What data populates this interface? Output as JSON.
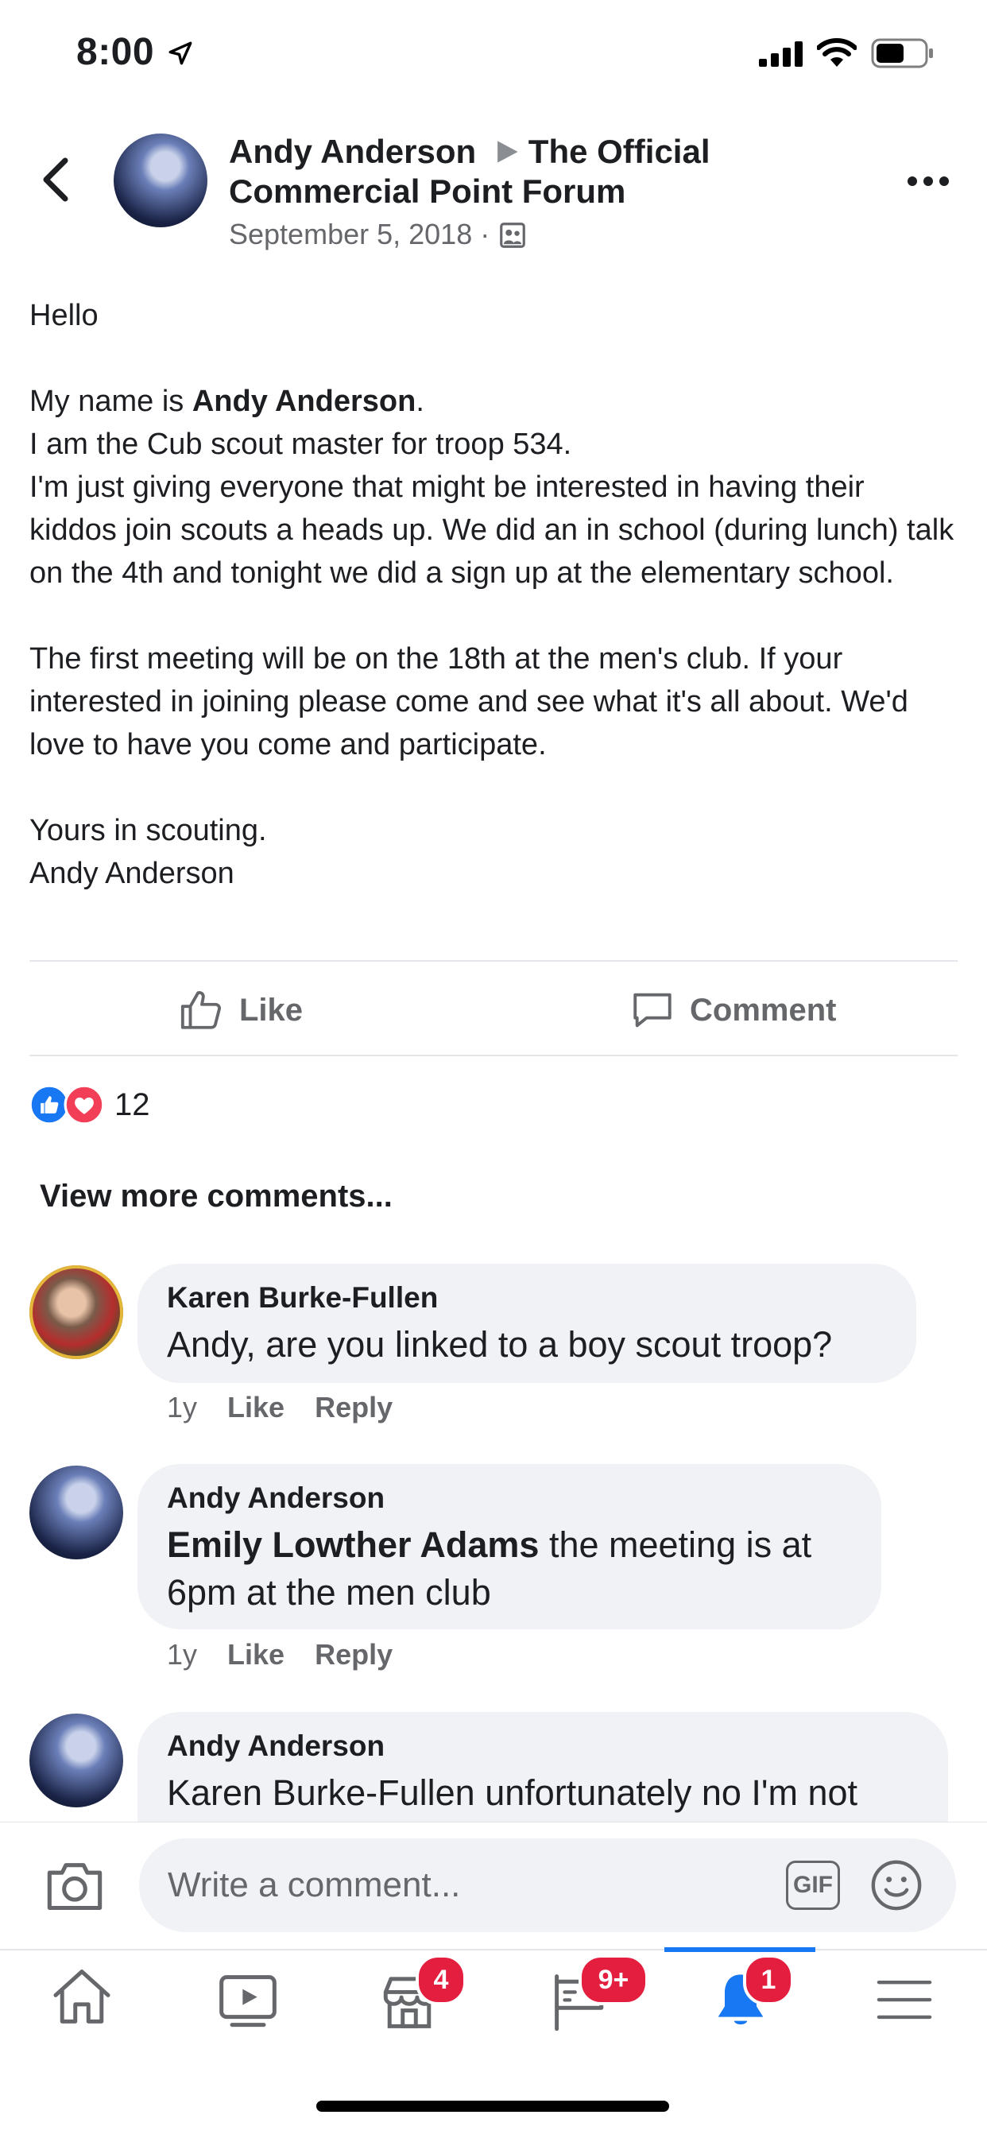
{
  "status_bar": {
    "time": "8:00"
  },
  "post": {
    "author": "Andy Anderson",
    "group": "The Official Commercial Point Forum",
    "date": "September 5, 2018",
    "greeting": "Hello",
    "para1_prefix": "My name is ",
    "para1_name": "Andy Anderson",
    "para1_suffix": ".",
    "para1_line2": "I am the Cub scout master for troop 534.",
    "para1_line3": "I'm just giving everyone that might be interested in having their kiddos join scouts a heads up. We did an in school (during lunch) talk on the 4th and tonight we did a sign up at the elementary school.",
    "para2": "The first meeting will be on the 18th at the men's club. If your interested in joining please come and see what it's all about. We'd love to have you come and participate.",
    "signoff1": "Yours in scouting.",
    "signoff2": "Andy Anderson"
  },
  "actions": {
    "like": "Like",
    "comment": "Comment"
  },
  "reactions": {
    "count": "12"
  },
  "comments_section": {
    "view_more": "View more comments..."
  },
  "comments": [
    {
      "author": "Karen Burke-Fullen",
      "mention": "",
      "text": "Andy, are you linked to a boy scout troop?",
      "time": "1y",
      "like": "Like",
      "reply": "Reply"
    },
    {
      "author": "Andy Anderson",
      "mention": "Emily Lowther Adams",
      "text": " the meeting is at 6pm at the men club",
      "time": "1y",
      "like": "Like",
      "reply": "Reply"
    },
    {
      "author": "Andy Anderson",
      "mention": "",
      "text": "Karen Burke-Fullen unfortunately no I'm not"
    }
  ],
  "composer": {
    "placeholder": "Write a comment...",
    "gif": "GIF"
  },
  "tab_bar": {
    "marketplace_badge": "4",
    "groups_badge": "9+",
    "notifications_badge": "1",
    "accent": "#1877f2"
  },
  "colors": {
    "badge": "#e41e3f",
    "like_blue": "#1877f2",
    "love_red": "#f33e58"
  }
}
